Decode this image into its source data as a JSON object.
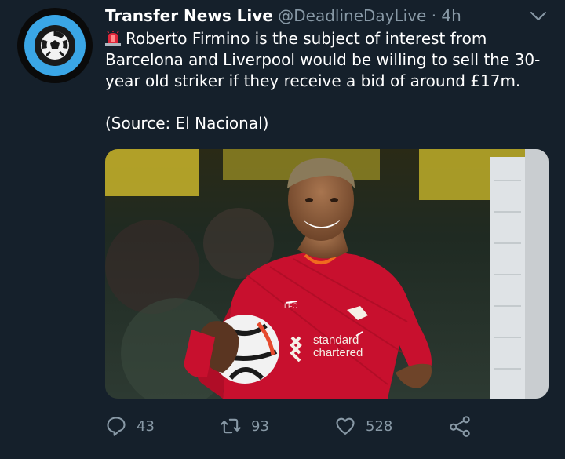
{
  "tweet": {
    "author_name": "Transfer News Live",
    "author_handle": "@DeadlineDayLive",
    "separator": "·",
    "time": "4h",
    "text_main": "Roberto Firmino is the subject of interest from Barcelona and Liverpool would be willing to sell the 30-year old striker if they receive a bid of around £17m.",
    "text_source": "(Source: El Nacional)",
    "emoji": "siren-icon"
  },
  "media": {
    "shirt_sponsor_line1": "standard",
    "shirt_sponsor_line2": "chartered",
    "shirt_badge": "LFC"
  },
  "actions": {
    "replies": "43",
    "retweets": "93",
    "likes": "528"
  },
  "colors": {
    "background": "#15202b",
    "secondary_text": "#8899a6",
    "accent": "#3aa6e6",
    "shirt_red": "#c8102e"
  }
}
